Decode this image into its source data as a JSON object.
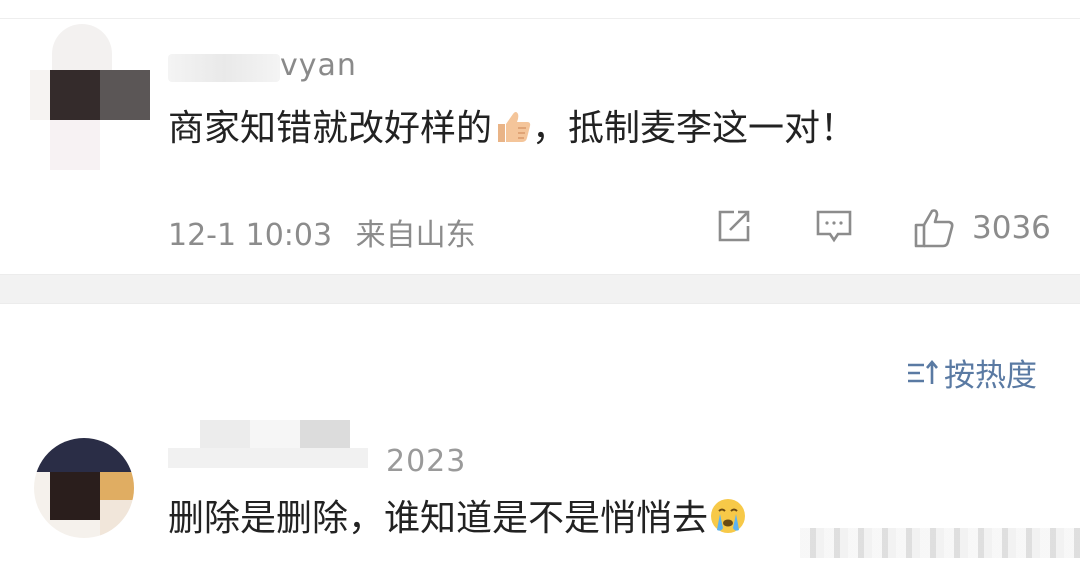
{
  "comment1": {
    "username_suffix": "vyan",
    "text": "商家知错就改好样的",
    "text_after_emoji": "，抵制麦李这一对！",
    "emoji": "thumbs-up",
    "time": "12-1 10:03",
    "location": "来自山东",
    "likes": "3036"
  },
  "sort": {
    "label": "按热度",
    "icon": "sort-icon"
  },
  "comment2": {
    "username_suffix": "2023",
    "text": "删除是删除，谁知道是不是悄悄去",
    "emoji": "crying-face"
  },
  "colors": {
    "text": "#222222",
    "meta": "#8c8c8c",
    "link": "#5a7aa3",
    "separator": "#f2f2f2"
  }
}
